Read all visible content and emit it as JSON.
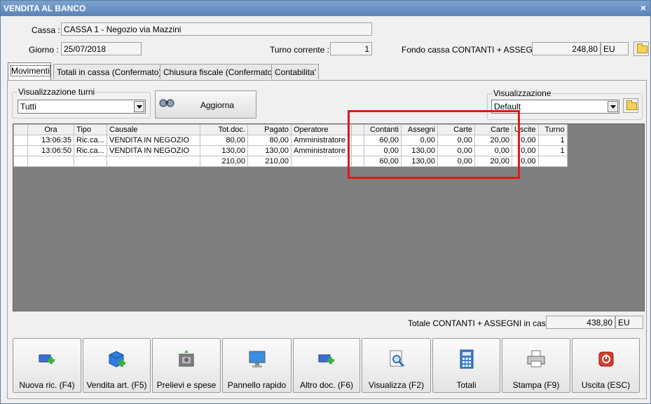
{
  "window": {
    "title": "VENDITA AL BANCO",
    "close": "×"
  },
  "header": {
    "cassa_label": "Cassa :",
    "cassa_value": "CASSA 1 - Negozio via Mazzini",
    "giorno_label": "Giorno :",
    "giorno_value": "25/07/2018",
    "turno_label": "Turno corrente :",
    "turno_value": "1",
    "fondo_label": "Fondo cassa CONTANTI + ASSEGNI :",
    "fondo_value": "248,80",
    "fondo_currency": "EU"
  },
  "tabs": [
    {
      "label": "Movimenti",
      "active": true
    },
    {
      "label": "Totali in cassa (Confermato)"
    },
    {
      "label": "Chiusura fiscale (Confermato)"
    },
    {
      "label": "Contabilita'"
    }
  ],
  "filters": {
    "turni_label": "Visualizzazione turni",
    "turni_value": "Tutti",
    "aggiorna_label": "Aggiorna",
    "vis_label": "Visualizzazione",
    "vis_value": "Default"
  },
  "table": {
    "columns": [
      "",
      "Ora",
      "Tipo",
      "Causale",
      "Tot.doc.",
      "Pagato",
      "Operatore",
      "",
      "Contanti",
      "Assegni",
      "Carte",
      "Carte",
      "Uscite",
      "Turno"
    ],
    "rows": [
      [
        "",
        "13:06:35",
        "Ric.ca...",
        "VENDITA IN NEGOZIO",
        "80,00",
        "80,00",
        "Amministratore",
        "",
        "60,00",
        "0,00",
        "0,00",
        "20,00",
        "0,00",
        "1"
      ],
      [
        "",
        "13:06:50",
        "Ric.ca...",
        "VENDITA IN NEGOZIO",
        "130,00",
        "130,00",
        "Amministratore",
        "",
        "0,00",
        "130,00",
        "0,00",
        "0,00",
        "0,00",
        "1"
      ],
      [
        "",
        "",
        "",
        "",
        "210,00",
        "210,00",
        "",
        "",
        "60,00",
        "130,00",
        "0,00",
        "20,00",
        "0,00",
        ""
      ]
    ]
  },
  "totale": {
    "label": "Totale CONTANTI + ASSEGNI in cassa :",
    "value": "438,80",
    "currency": "EU"
  },
  "buttons": [
    {
      "label": "Nuova ric. (F4)",
      "icon": "new-receipt-icon"
    },
    {
      "label": "Vendita art. (F5)",
      "icon": "sell-item-icon"
    },
    {
      "label": "Prelievi e spese",
      "icon": "safe-icon"
    },
    {
      "label": "Pannello rapido",
      "icon": "monitor-icon"
    },
    {
      "label": "Altro doc. (F6)",
      "icon": "other-doc-icon"
    },
    {
      "label": "Visualizza (F2)",
      "icon": "view-icon"
    },
    {
      "label": "Totali",
      "icon": "calculator-icon"
    },
    {
      "label": "Stampa (F9)",
      "icon": "printer-icon"
    },
    {
      "label": "Uscita (ESC)",
      "icon": "exit-icon"
    }
  ],
  "colors": {
    "title_bar": "#5b83b9",
    "grid_bg": "#7f7f7f",
    "highlight": "#e01818"
  }
}
